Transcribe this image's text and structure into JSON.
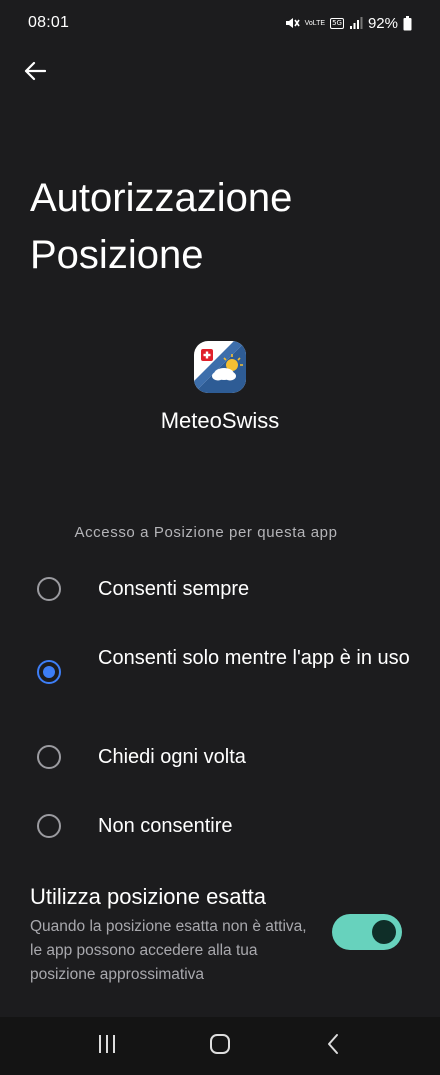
{
  "status_bar": {
    "time": "08:01",
    "volte": "VoLTE",
    "network": "5G",
    "battery": "92%"
  },
  "icons": {
    "back": "arrow-left-icon",
    "mute": "mute-icon",
    "signal": "signal-icon",
    "battery": "battery-icon"
  },
  "page": {
    "title_line1": "Autorizzazione",
    "title_line2": "Posizione"
  },
  "app": {
    "name": "MeteoSwiss"
  },
  "location_access": {
    "section_label": "Accesso a Posizione per questa app",
    "options": [
      {
        "label": "Consenti sempre",
        "selected": false
      },
      {
        "label": "Consenti solo mentre l'app è in uso",
        "selected": true
      },
      {
        "label": "Chiedi ogni volta",
        "selected": false
      },
      {
        "label": "Non consentire",
        "selected": false
      }
    ]
  },
  "precise_location": {
    "title": "Utilizza posizione esatta",
    "description": "Quando la posizione esatta non è attiva, le app possono accedere alla tua posizione approssimativa",
    "enabled": true
  },
  "colors": {
    "background": "#1c1c1e",
    "accent_radio": "#3d7ef7",
    "toggle_on": "#67d2bd",
    "secondary_text": "#a8a8ad"
  }
}
